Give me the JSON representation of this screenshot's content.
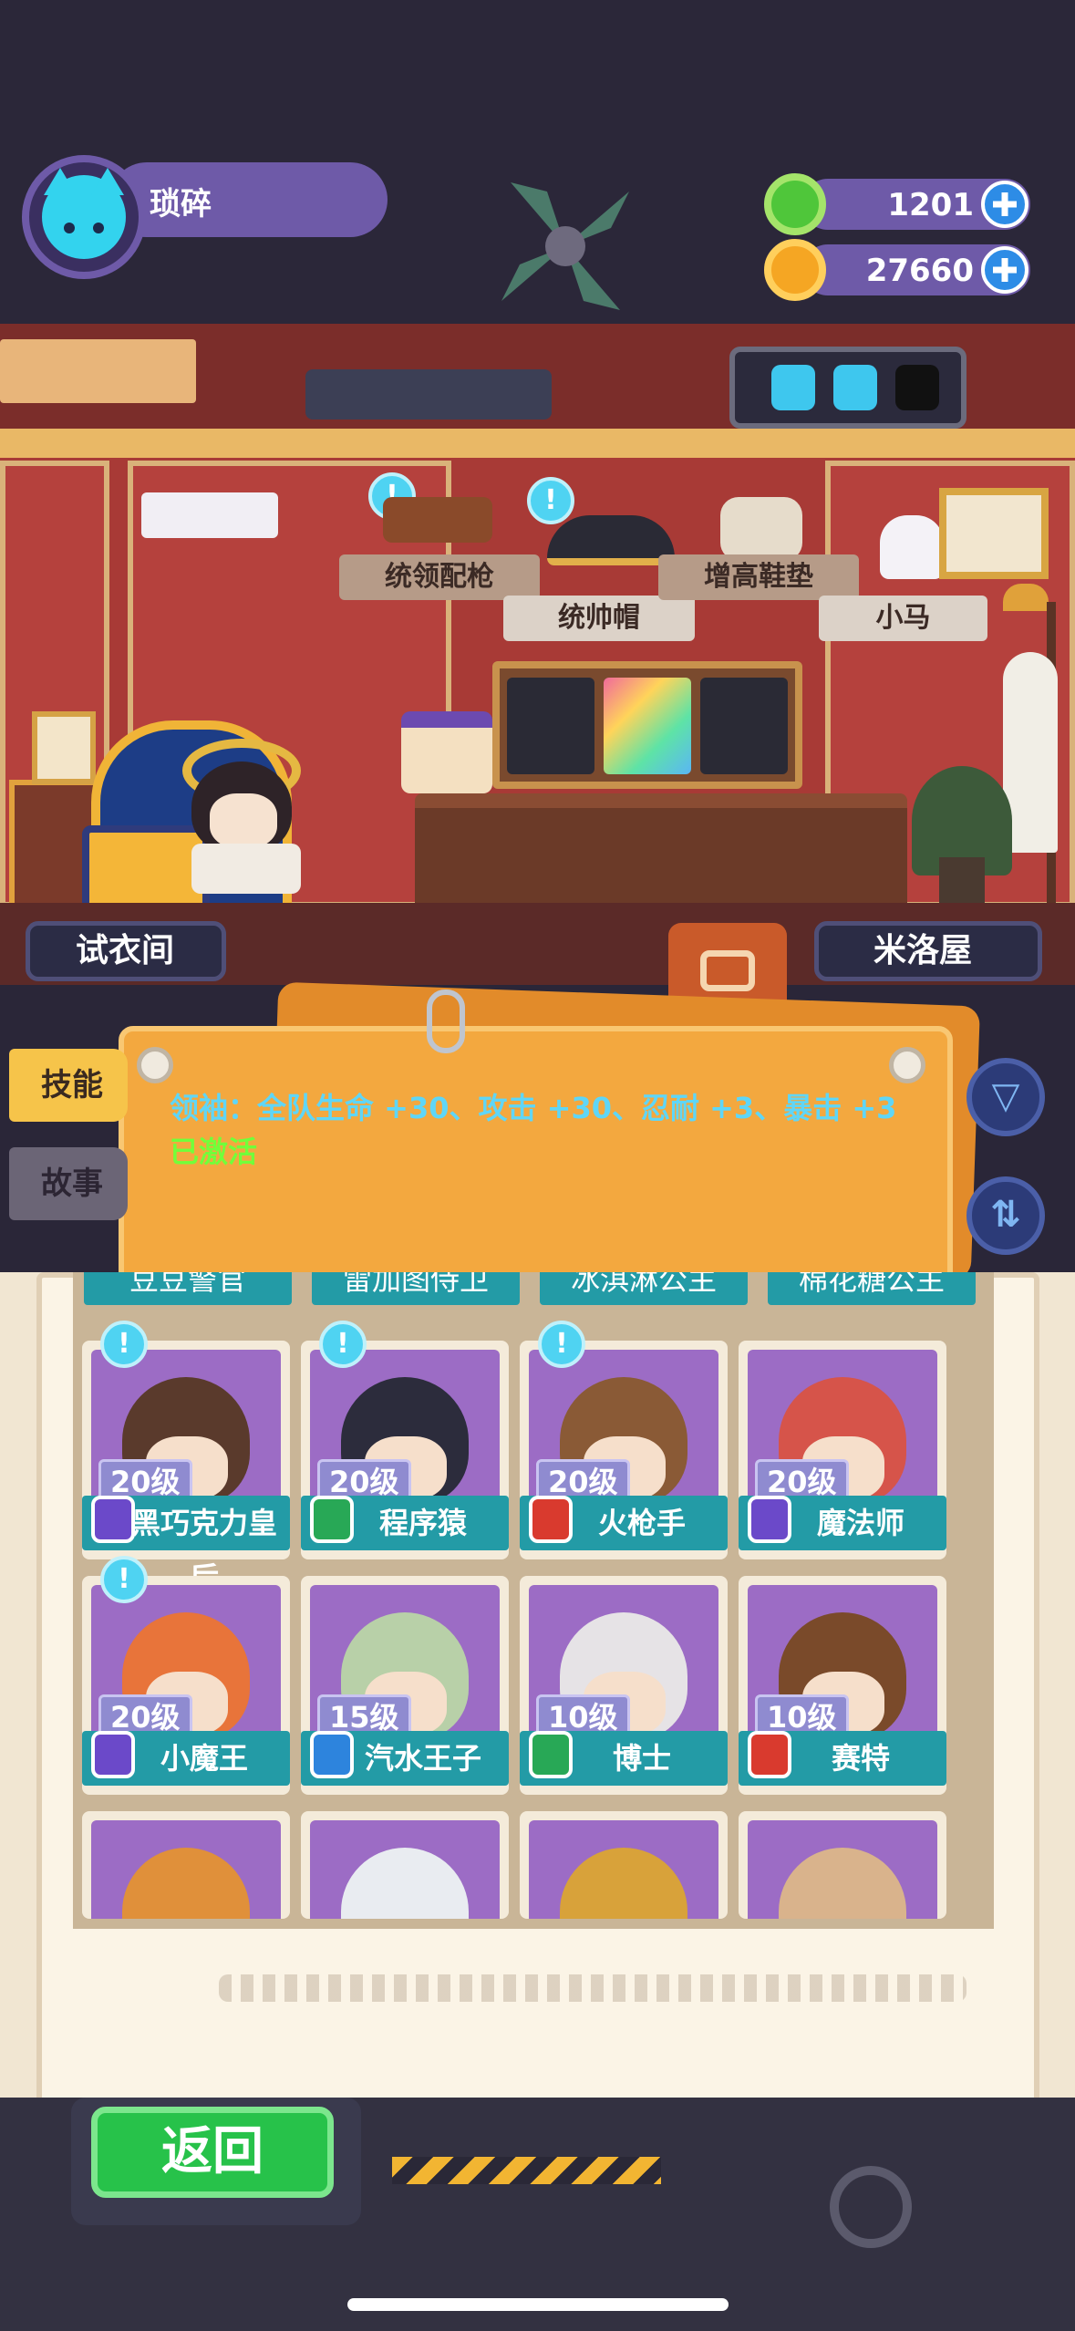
{
  "player": {
    "name": "琐碎"
  },
  "currency": {
    "green": {
      "value": "1201",
      "color": "#4fc63a",
      "icon": "green-donut-coin-icon"
    },
    "gold": {
      "value": "27660",
      "color": "#f5a623",
      "icon": "planet-coin-icon"
    }
  },
  "room": {
    "items": [
      {
        "label": "统领配枪",
        "has_alert": true
      },
      {
        "label": "统帅帽",
        "has_alert": true
      },
      {
        "label": "增高鞋垫",
        "has_alert": false
      },
      {
        "label": "小马",
        "has_alert": false
      }
    ],
    "nav_left": "试衣间",
    "nav_right": "米洛屋",
    "energy_slots": 3,
    "energy_filled": 2
  },
  "board": {
    "text": "领袖：全队生命 +30、攻击 +30、忍耐 +3、暴击 +3",
    "status": "已激活"
  },
  "tabs": {
    "skills": "技能",
    "story": "故事"
  },
  "characters_partial_row": [
    "豆豆警官",
    "雷加图侍卫",
    "冰淇淋公主",
    "棉花糖公主"
  ],
  "characters": [
    {
      "name": "黑巧克力皇后",
      "level": "20级",
      "badge_color": "#6b49c9",
      "hair": "#5a3a2c",
      "alert": true
    },
    {
      "name": "程序猿",
      "level": "20级",
      "badge_color": "#28a856",
      "hair": "#2c2c3c",
      "alert": true
    },
    {
      "name": "火枪手",
      "level": "20级",
      "badge_color": "#d93a2e",
      "hair": "#8a5a36",
      "alert": true
    },
    {
      "name": "魔法师",
      "level": "20级",
      "badge_color": "#6b49c9",
      "hair": "#d6544a",
      "alert": false
    },
    {
      "name": "小魔王",
      "level": "20级",
      "badge_color": "#6b49c9",
      "hair": "#e8743a",
      "alert": true
    },
    {
      "name": "汽水王子",
      "level": "15级",
      "badge_color": "#2d84dd",
      "hair": "#b8d0a8",
      "alert": false
    },
    {
      "name": "博士",
      "level": "10级",
      "badge_color": "#28a856",
      "hair": "#e6e3e6",
      "alert": false
    },
    {
      "name": "赛特",
      "level": "10级",
      "badge_color": "#d93a2e",
      "hair": "#7a4a2a",
      "alert": false
    }
  ],
  "characters_cut_row": [
    {
      "hair": "#e0903a"
    },
    {
      "hair": "#e9ecf1"
    },
    {
      "hair": "#d8a23a"
    },
    {
      "hair": "#d9b38c"
    }
  ],
  "back_button": "返回"
}
